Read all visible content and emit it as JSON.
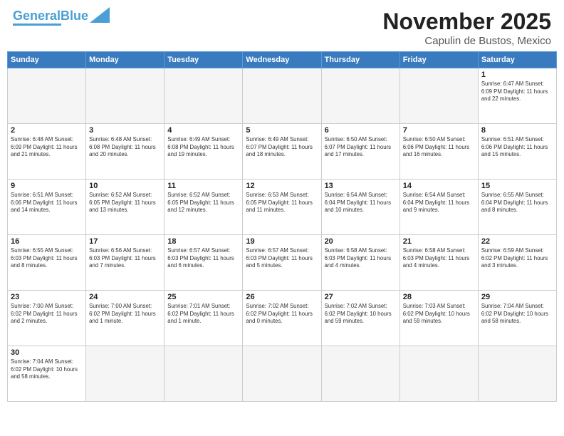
{
  "header": {
    "logo_general": "General",
    "logo_blue": "Blue",
    "title": "November 2025",
    "subtitle": "Capulin de Bustos, Mexico"
  },
  "days_of_week": [
    "Sunday",
    "Monday",
    "Tuesday",
    "Wednesday",
    "Thursday",
    "Friday",
    "Saturday"
  ],
  "weeks": [
    [
      {
        "day": "",
        "info": "",
        "empty": true
      },
      {
        "day": "",
        "info": "",
        "empty": true
      },
      {
        "day": "",
        "info": "",
        "empty": true
      },
      {
        "day": "",
        "info": "",
        "empty": true
      },
      {
        "day": "",
        "info": "",
        "empty": true
      },
      {
        "day": "",
        "info": "",
        "empty": true
      },
      {
        "day": "1",
        "info": "Sunrise: 6:47 AM\nSunset: 6:09 PM\nDaylight: 11 hours\nand 22 minutes."
      }
    ],
    [
      {
        "day": "2",
        "info": "Sunrise: 6:48 AM\nSunset: 6:09 PM\nDaylight: 11 hours\nand 21 minutes."
      },
      {
        "day": "3",
        "info": "Sunrise: 6:48 AM\nSunset: 6:08 PM\nDaylight: 11 hours\nand 20 minutes."
      },
      {
        "day": "4",
        "info": "Sunrise: 6:49 AM\nSunset: 6:08 PM\nDaylight: 11 hours\nand 19 minutes."
      },
      {
        "day": "5",
        "info": "Sunrise: 6:49 AM\nSunset: 6:07 PM\nDaylight: 11 hours\nand 18 minutes."
      },
      {
        "day": "6",
        "info": "Sunrise: 6:50 AM\nSunset: 6:07 PM\nDaylight: 11 hours\nand 17 minutes."
      },
      {
        "day": "7",
        "info": "Sunrise: 6:50 AM\nSunset: 6:06 PM\nDaylight: 11 hours\nand 16 minutes."
      },
      {
        "day": "8",
        "info": "Sunrise: 6:51 AM\nSunset: 6:06 PM\nDaylight: 11 hours\nand 15 minutes."
      }
    ],
    [
      {
        "day": "9",
        "info": "Sunrise: 6:51 AM\nSunset: 6:06 PM\nDaylight: 11 hours\nand 14 minutes."
      },
      {
        "day": "10",
        "info": "Sunrise: 6:52 AM\nSunset: 6:05 PM\nDaylight: 11 hours\nand 13 minutes."
      },
      {
        "day": "11",
        "info": "Sunrise: 6:52 AM\nSunset: 6:05 PM\nDaylight: 11 hours\nand 12 minutes."
      },
      {
        "day": "12",
        "info": "Sunrise: 6:53 AM\nSunset: 6:05 PM\nDaylight: 11 hours\nand 11 minutes."
      },
      {
        "day": "13",
        "info": "Sunrise: 6:54 AM\nSunset: 6:04 PM\nDaylight: 11 hours\nand 10 minutes."
      },
      {
        "day": "14",
        "info": "Sunrise: 6:54 AM\nSunset: 6:04 PM\nDaylight: 11 hours\nand 9 minutes."
      },
      {
        "day": "15",
        "info": "Sunrise: 6:55 AM\nSunset: 6:04 PM\nDaylight: 11 hours\nand 8 minutes."
      }
    ],
    [
      {
        "day": "16",
        "info": "Sunrise: 6:55 AM\nSunset: 6:03 PM\nDaylight: 11 hours\nand 8 minutes."
      },
      {
        "day": "17",
        "info": "Sunrise: 6:56 AM\nSunset: 6:03 PM\nDaylight: 11 hours\nand 7 minutes."
      },
      {
        "day": "18",
        "info": "Sunrise: 6:57 AM\nSunset: 6:03 PM\nDaylight: 11 hours\nand 6 minutes."
      },
      {
        "day": "19",
        "info": "Sunrise: 6:57 AM\nSunset: 6:03 PM\nDaylight: 11 hours\nand 5 minutes."
      },
      {
        "day": "20",
        "info": "Sunrise: 6:58 AM\nSunset: 6:03 PM\nDaylight: 11 hours\nand 4 minutes."
      },
      {
        "day": "21",
        "info": "Sunrise: 6:58 AM\nSunset: 6:03 PM\nDaylight: 11 hours\nand 4 minutes."
      },
      {
        "day": "22",
        "info": "Sunrise: 6:59 AM\nSunset: 6:02 PM\nDaylight: 11 hours\nand 3 minutes."
      }
    ],
    [
      {
        "day": "23",
        "info": "Sunrise: 7:00 AM\nSunset: 6:02 PM\nDaylight: 11 hours\nand 2 minutes."
      },
      {
        "day": "24",
        "info": "Sunrise: 7:00 AM\nSunset: 6:02 PM\nDaylight: 11 hours\nand 1 minute."
      },
      {
        "day": "25",
        "info": "Sunrise: 7:01 AM\nSunset: 6:02 PM\nDaylight: 11 hours\nand 1 minute."
      },
      {
        "day": "26",
        "info": "Sunrise: 7:02 AM\nSunset: 6:02 PM\nDaylight: 11 hours\nand 0 minutes."
      },
      {
        "day": "27",
        "info": "Sunrise: 7:02 AM\nSunset: 6:02 PM\nDaylight: 10 hours\nand 59 minutes."
      },
      {
        "day": "28",
        "info": "Sunrise: 7:03 AM\nSunset: 6:02 PM\nDaylight: 10 hours\nand 59 minutes."
      },
      {
        "day": "29",
        "info": "Sunrise: 7:04 AM\nSunset: 6:02 PM\nDaylight: 10 hours\nand 58 minutes."
      }
    ],
    [
      {
        "day": "30",
        "info": "Sunrise: 7:04 AM\nSunset: 6:02 PM\nDaylight: 10 hours\nand 58 minutes."
      },
      {
        "day": "",
        "info": "",
        "empty": true
      },
      {
        "day": "",
        "info": "",
        "empty": true
      },
      {
        "day": "",
        "info": "",
        "empty": true
      },
      {
        "day": "",
        "info": "",
        "empty": true
      },
      {
        "day": "",
        "info": "",
        "empty": true
      },
      {
        "day": "",
        "info": "",
        "empty": true
      }
    ]
  ]
}
